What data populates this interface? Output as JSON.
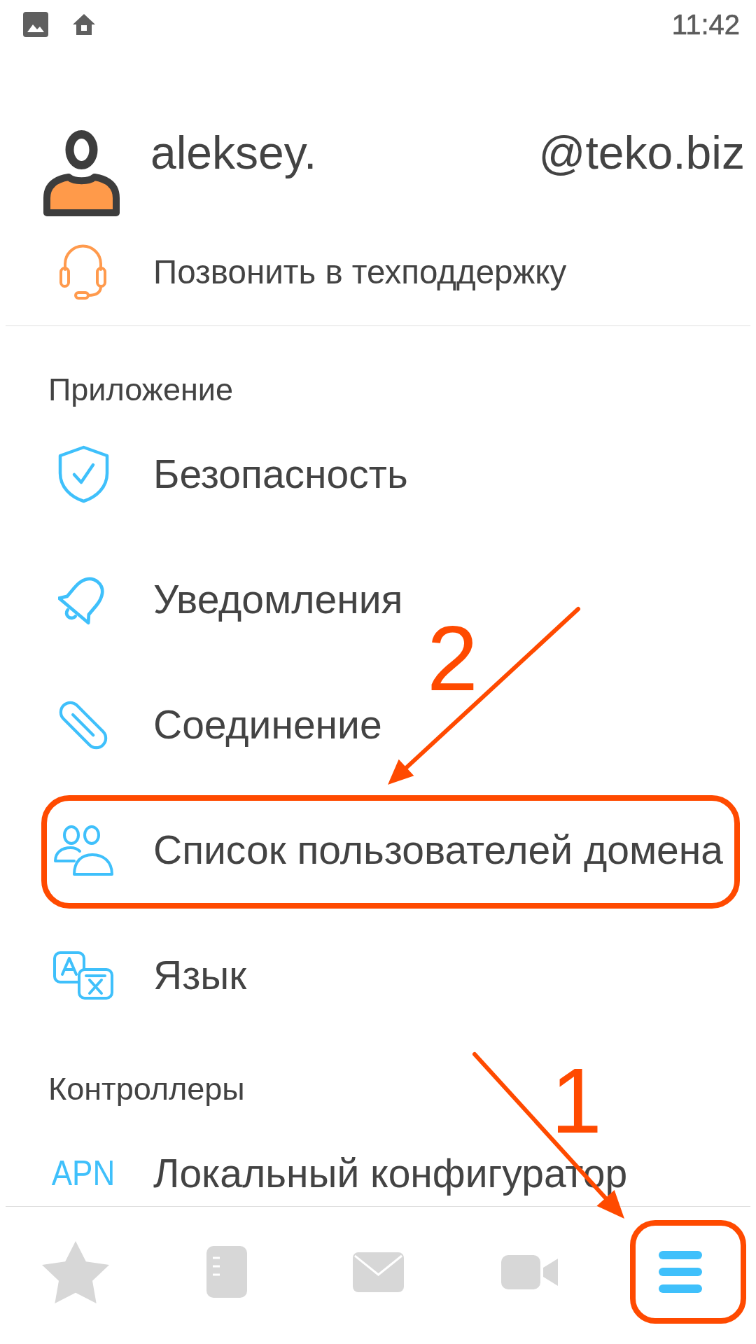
{
  "status_bar": {
    "time": "11:42"
  },
  "account": {
    "local_part": "aleksey.",
    "domain": "@teko.biz"
  },
  "support": {
    "label": "Позвонить в техподдержку"
  },
  "sections": [
    {
      "title": "Приложение",
      "items": [
        {
          "label": "Безопасность",
          "highlighted": false
        },
        {
          "label": "Уведомления",
          "highlighted": false
        },
        {
          "label": "Соединение",
          "highlighted": false
        },
        {
          "label": "Список пользователей домена",
          "highlighted": true
        },
        {
          "label": "Язык",
          "highlighted": false
        }
      ]
    },
    {
      "title": "Контроллеры",
      "items": [
        {
          "label": "Локальный конфигуратор",
          "icon_text": "APN",
          "highlighted": false
        }
      ]
    }
  ],
  "bottom_nav": [
    {
      "selected": false,
      "highlighted": false
    },
    {
      "selected": false,
      "highlighted": false
    },
    {
      "selected": false,
      "highlighted": false
    },
    {
      "selected": false,
      "highlighted": false
    },
    {
      "selected": true,
      "highlighted": true
    }
  ],
  "annotations": [
    {
      "label": "2"
    },
    {
      "label": "1"
    }
  ]
}
